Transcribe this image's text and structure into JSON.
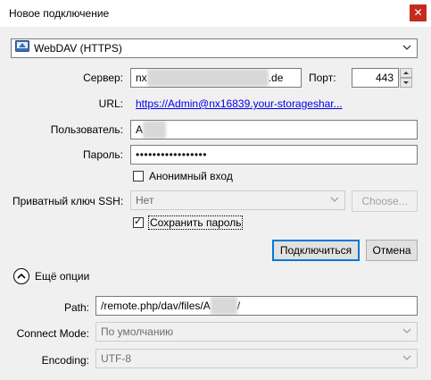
{
  "window": {
    "title": "Новое подключение",
    "close_glyph": "✕"
  },
  "protocol": {
    "selected": "WebDAV (HTTPS)"
  },
  "server": {
    "label": "Сервер:",
    "value_prefix": "nx",
    "value_suffix": ".de"
  },
  "port": {
    "label": "Порт:",
    "value": "443"
  },
  "url": {
    "label": "URL:",
    "value": "https://Admin@nx16839.your-storageshar..."
  },
  "user": {
    "label": "Пользователь:",
    "value_prefix": "A"
  },
  "password": {
    "label": "Пароль:",
    "value": "•••••••••••••••••"
  },
  "anonymous": {
    "label": "Анонимный вход",
    "checked": false
  },
  "ssh": {
    "label": "Приватный ключ SSH:",
    "value": "Нет",
    "choose_label": "Choose..."
  },
  "save_password": {
    "label": "Сохранить пароль",
    "checked": true,
    "check_glyph": "✓"
  },
  "buttons": {
    "connect": "Подключиться",
    "cancel": "Отмена"
  },
  "more_options": {
    "label": "Ещё опции"
  },
  "path": {
    "label": "Path:",
    "value_prefix": "/remote.php/dav/files/A",
    "value_suffix": "/"
  },
  "connect_mode": {
    "label": "Connect Mode:",
    "value": "По умолчанию"
  },
  "encoding": {
    "label": "Encoding:",
    "value": "UTF-8"
  },
  "colors": {
    "close": "#c42b1c",
    "link": "#0000ee",
    "default_button_border": "#0078d7",
    "panel_bg": "#f0f0f0"
  }
}
